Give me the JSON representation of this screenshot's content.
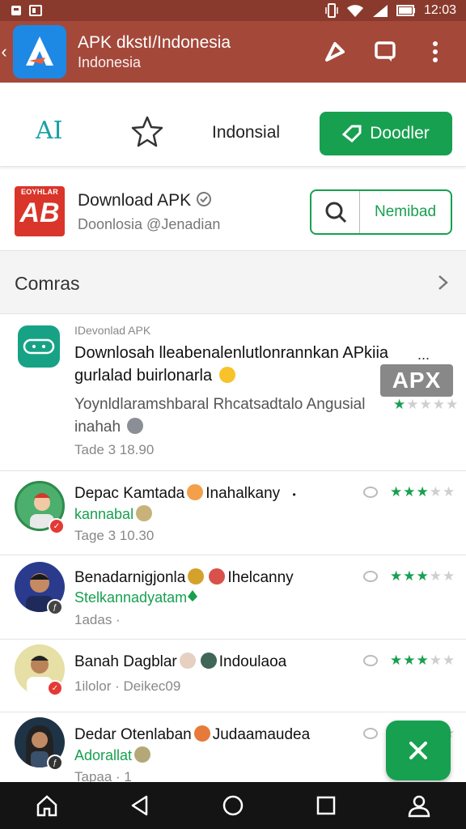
{
  "status_bar": {
    "time": "12:03",
    "left_icons": [
      "notification-icon",
      "photo-icon"
    ],
    "right_icons": [
      "vibrate-icon",
      "wifi-icon",
      "signal-icon",
      "battery-icon"
    ]
  },
  "app_bar": {
    "title": "APK dkstI/Indonesia",
    "subtitle": "Indonesia",
    "icons": [
      "back-icon",
      "edit-icon",
      "chat-icon",
      "more-vert-icon"
    ],
    "accent": "#a4483a"
  },
  "tabs": {
    "ai_label": "AI",
    "center_label": "Indonsial",
    "download_label": "Doodler"
  },
  "app_info": {
    "logo_small_text": "EOYHLAR",
    "logo_big_text": "AB",
    "title": "Download APK",
    "subtitle": "Doonlosia @Jenadian",
    "search_button_label": "Nemibad"
  },
  "section": {
    "title": "Comras"
  },
  "featured": {
    "label": "IDevonlad APK",
    "title": "Downlosah lleabenalenlutlonrannkan APkiia gurlalad buirlonarla",
    "more": "...",
    "badge": "APX",
    "description": "Yoynldlaramshbaral Rhcatsadtalo Angusial inahah",
    "time": "Tade 3 18.90",
    "rating": 1,
    "rating_max": 5
  },
  "reviews": [
    {
      "name_a": "Depac Kamtada",
      "name_b": "Inahalkany",
      "name_suffix": "•",
      "sub": "kannabal",
      "time": "Tage 3 10.30",
      "rating": 3,
      "badge_color": "#e53935"
    },
    {
      "name_a": "Benadarnigjonla",
      "name_b": "Ihelcanny",
      "name_suffix": "",
      "sub": "Stelkannadyatam",
      "time": "1adas ·",
      "rating": 3,
      "badge_color": "#444444"
    },
    {
      "name_a": "Banah Dagblar",
      "name_b": "Indoulaoa",
      "name_suffix": "",
      "sub": "",
      "time": "1ilolor · Deikec09",
      "rating": 3,
      "badge_color": "#e53935"
    },
    {
      "name_a": "Dedar Otenlaban",
      "name_b": "Judaamaudea",
      "name_suffix": "",
      "sub": "Adorallat",
      "time": "Tapaa · 1",
      "rating": 3,
      "badge_color": "#333333"
    }
  ],
  "nav_bar": {
    "icons": [
      "home-icon",
      "back-triangle-icon",
      "circle-home-icon",
      "recents-icon",
      "account-icon"
    ]
  },
  "fab": {
    "icon": "close-icon"
  }
}
